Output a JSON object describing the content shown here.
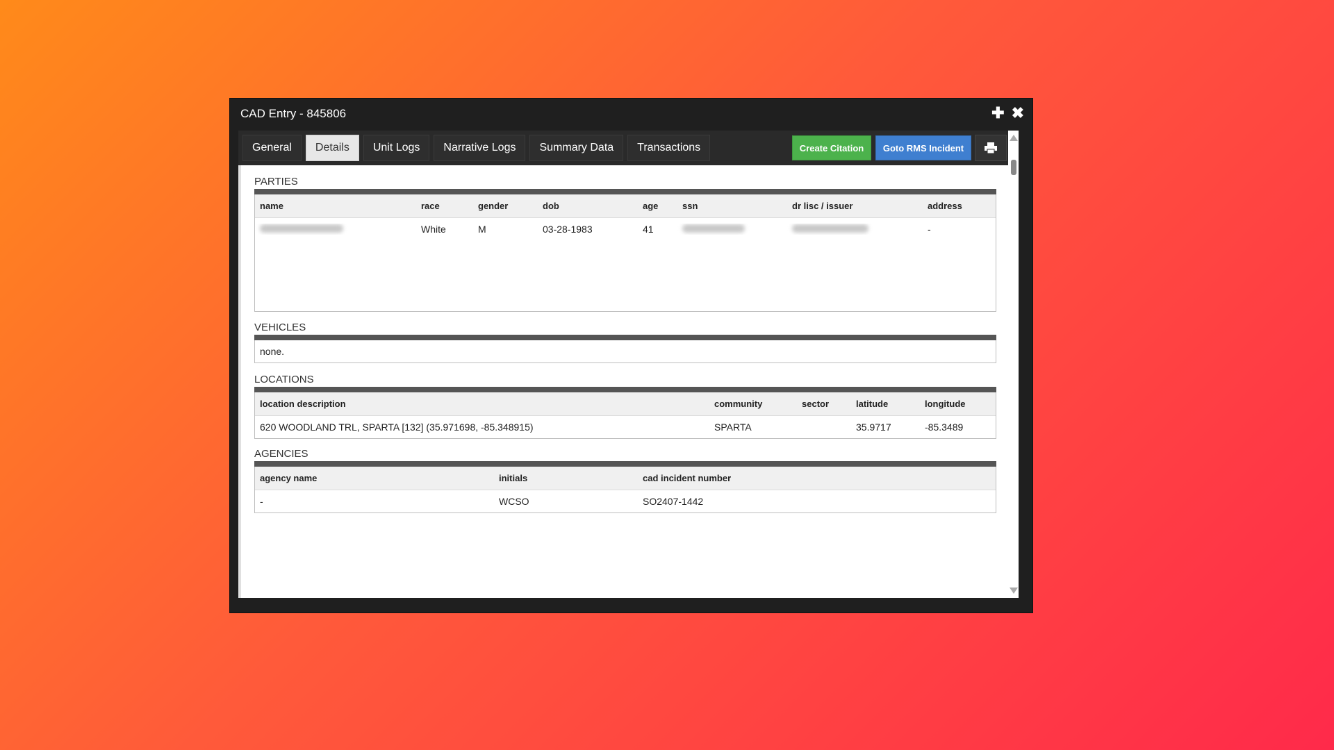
{
  "window": {
    "title": "CAD Entry - 845806"
  },
  "tabs": [
    {
      "label": "General"
    },
    {
      "label": "Details"
    },
    {
      "label": "Unit Logs"
    },
    {
      "label": "Narrative Logs"
    },
    {
      "label": "Summary Data"
    },
    {
      "label": "Transactions"
    }
  ],
  "actions": {
    "create_citation": "Create Citation",
    "goto_rms": "Goto RMS Incident"
  },
  "parties": {
    "title": "PARTIES",
    "columns": [
      "name",
      "race",
      "gender",
      "dob",
      "age",
      "ssn",
      "dr lisc / issuer",
      "address"
    ],
    "rows": [
      {
        "name": "",
        "race": "White",
        "gender": "M",
        "dob": "03-28-1983",
        "age": "41",
        "ssn": "",
        "dr_lisc": "",
        "address": "-"
      }
    ]
  },
  "vehicles": {
    "title": "VEHICLES",
    "empty_text": "none."
  },
  "locations": {
    "title": "LOCATIONS",
    "columns": [
      "location description",
      "community",
      "sector",
      "latitude",
      "longitude"
    ],
    "rows": [
      {
        "description": "620 WOODLAND TRL, SPARTA [132] (35.971698, -85.348915)",
        "community": "SPARTA",
        "sector": "",
        "latitude": "35.9717",
        "longitude": "-85.3489"
      }
    ]
  },
  "agencies": {
    "title": "AGENCIES",
    "columns": [
      "agency name",
      "initials",
      "cad incident number"
    ],
    "rows": [
      {
        "agency_name": "-",
        "initials": "WCSO",
        "cad_incident_number": "SO2407-1442"
      }
    ]
  }
}
